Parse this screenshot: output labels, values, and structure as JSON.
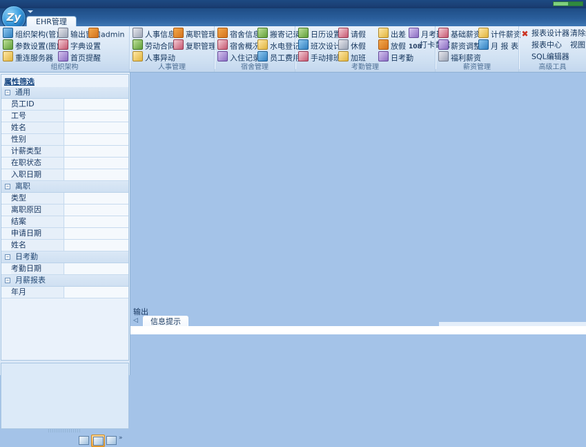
{
  "titlebar": {
    "progress_percent": 50
  },
  "app": {
    "logo_text": "Zy",
    "tab_label": "EHR管理"
  },
  "ribbon": {
    "groups": [
      {
        "title": "组织架构",
        "items": [
          {
            "label": "组织架构(管)",
            "icon": "org-chart-icon",
            "col": 0,
            "row": 0
          },
          {
            "label": "输出窗口",
            "icon": "speaker-icon",
            "col": 1,
            "row": 0
          },
          {
            "label": "admin",
            "icon": "user-icon",
            "col": 2,
            "row": 0
          },
          {
            "label": "参数设置(图)",
            "icon": "gear-icon",
            "col": 0,
            "row": 1
          },
          {
            "label": "字典设置",
            "icon": "dictionary-icon",
            "col": 1,
            "row": 1
          },
          {
            "label": "重连服务器",
            "icon": "server-icon",
            "col": 0,
            "row": 2
          },
          {
            "label": "首页提醒",
            "icon": "home-bell-icon",
            "col": 1,
            "row": 2
          }
        ]
      },
      {
        "title": "人事管理",
        "items": [
          {
            "label": "人事信息",
            "icon": "personnel-info-icon",
            "col": 0,
            "row": 0
          },
          {
            "label": "离职管理",
            "icon": "resign-icon",
            "col": 1,
            "row": 0
          },
          {
            "label": "劳动合同",
            "icon": "contract-icon",
            "col": 0,
            "row": 1
          },
          {
            "label": "复职管理",
            "icon": "rehire-icon",
            "col": 1,
            "row": 1
          },
          {
            "label": "人事异动",
            "icon": "transfer-icon",
            "col": 0,
            "row": 2
          }
        ]
      },
      {
        "title": "宿舍管理",
        "items": [
          {
            "label": "宿舍信息",
            "icon": "dorm-info-icon",
            "col": 0,
            "row": 0
          },
          {
            "label": "搬寄记录",
            "icon": "move-record-icon",
            "col": 1,
            "row": 0
          },
          {
            "label": "宿舍概况",
            "icon": "dorm-overview-icon",
            "col": 0,
            "row": 1
          },
          {
            "label": "水电登记",
            "icon": "utility-icon",
            "col": 1,
            "row": 1
          },
          {
            "label": "入住记录",
            "icon": "checkin-icon",
            "col": 0,
            "row": 2
          },
          {
            "label": "员工费用",
            "icon": "employee-fee-icon",
            "col": 1,
            "row": 2
          }
        ]
      },
      {
        "title": "考勤管理",
        "items": [
          {
            "label": "日历设置",
            "icon": "calendar-icon",
            "col": 0,
            "row": 0
          },
          {
            "label": "请假",
            "icon": "leave-icon",
            "col": 1,
            "row": 0
          },
          {
            "label": "出差",
            "icon": "business-trip-icon",
            "col": 2,
            "row": 0
          },
          {
            "label": "月考勤",
            "icon": "month-attendance-icon",
            "col": 3,
            "row": 0
          },
          {
            "label": "班次设计",
            "icon": "shift-design-icon",
            "col": 0,
            "row": 1
          },
          {
            "label": "休假",
            "icon": "vacation-icon",
            "col": 1,
            "row": 1
          },
          {
            "label": "放假",
            "icon": "holiday-icon",
            "col": 2,
            "row": 1
          },
          {
            "label": "打卡数据",
            "icon": "punch-data-icon",
            "col": 3,
            "row": 1
          },
          {
            "label": "手动排班",
            "icon": "manual-schedule-icon",
            "col": 0,
            "row": 2
          },
          {
            "label": "加班",
            "icon": "overtime-icon",
            "col": 1,
            "row": 2
          },
          {
            "label": "日考勤",
            "icon": "day-attendance-icon",
            "col": 2,
            "row": 2
          }
        ]
      },
      {
        "title": "薪资管理",
        "items": [
          {
            "label": "基础薪资",
            "icon": "base-salary-icon",
            "col": 0,
            "row": 0
          },
          {
            "label": "计件薪资",
            "icon": "piece-salary-icon",
            "col": 1,
            "row": 0
          },
          {
            "label": "薪资调整",
            "icon": "salary-adjust-icon",
            "col": 0,
            "row": 1
          },
          {
            "label": "月 报 表",
            "icon": "month-report-icon",
            "col": 1,
            "row": 1
          },
          {
            "label": "福利薪资",
            "icon": "welfare-salary-icon",
            "col": 0,
            "row": 2
          }
        ]
      },
      {
        "title": "高级工具",
        "items": [
          {
            "label": "报表设计器",
            "icon": "report-designer-icon",
            "col": 0,
            "row": 0
          },
          {
            "label": "清除缓",
            "icon": "clear-cache-icon",
            "col": 1,
            "row": 0
          },
          {
            "label": "报表中心",
            "icon": "report-center-icon",
            "col": 0,
            "row": 1
          },
          {
            "label": "视图高",
            "icon": "view-advanced-icon",
            "col": 1,
            "row": 1
          },
          {
            "label": "SQL编辑器",
            "icon": "sql-editor-icon",
            "col": 0,
            "row": 2
          }
        ]
      }
    ]
  },
  "left_panel": {
    "title": "属性筛选",
    "groups": [
      {
        "label": "通用",
        "expanded": true,
        "fields": [
          {
            "label": "员工ID",
            "value": ""
          },
          {
            "label": "工号",
            "value": ""
          },
          {
            "label": "姓名",
            "value": ""
          },
          {
            "label": "性别",
            "value": ""
          },
          {
            "label": "计薪类型",
            "value": ""
          },
          {
            "label": "在职状态",
            "value": ""
          },
          {
            "label": "入职日期",
            "value": ""
          }
        ]
      },
      {
        "label": "离职",
        "expanded": true,
        "fields": [
          {
            "label": "类型",
            "value": ""
          },
          {
            "label": "离职原因",
            "value": ""
          },
          {
            "label": "结案",
            "value": ""
          },
          {
            "label": "申请日期",
            "value": ""
          },
          {
            "label": "姓名",
            "value": ""
          }
        ]
      },
      {
        "label": "日考勤",
        "expanded": true,
        "fields": [
          {
            "label": "考勤日期",
            "value": ""
          }
        ]
      },
      {
        "label": "月薪报表",
        "expanded": true,
        "fields": [
          {
            "label": "年月",
            "value": ""
          }
        ]
      }
    ],
    "tools": [
      {
        "name": "grid-view-icon",
        "selected": false
      },
      {
        "name": "properties-view-icon",
        "selected": true
      },
      {
        "name": "image-view-icon",
        "selected": false
      }
    ],
    "chevron": "»"
  },
  "output_panel": {
    "title": "输出",
    "scroll_left": "◁",
    "tabs": [
      {
        "label": "信息提示",
        "active": true
      }
    ],
    "content": ""
  },
  "colors": {
    "accent": "#1d4a82",
    "workspace": "#a4c3e8",
    "ribbon_bg": "#dbe8f6",
    "progress_green": "#7ed07e"
  }
}
